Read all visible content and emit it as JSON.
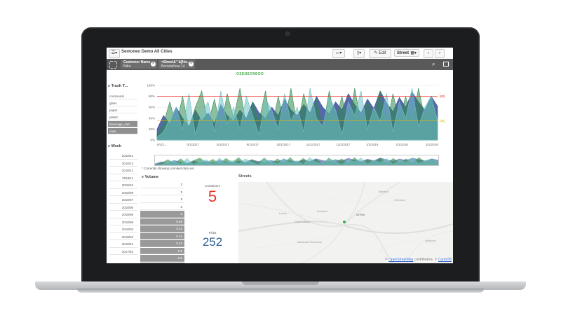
{
  "toolbar": {
    "app_title": "Semoneo Demo All Cities",
    "edit_label": "Edit",
    "sheet_name": "Street"
  },
  "selections": [
    {
      "field": "Customer Name",
      "value": "Nitra"
    },
    {
      "field": "=Street&' '&[Ho...",
      "value": "Borodačova 14"
    }
  ],
  "sheet_title": "OSENSONEOO",
  "trash_panel": {
    "title": "Trash T...",
    "items": [
      {
        "label": "communal",
        "selected": false
      },
      {
        "label": "glass",
        "selected": false
      },
      {
        "label": "paper",
        "selected": false
      },
      {
        "label": "plastic",
        "selected": false
      },
      {
        "label": "beverage_cart...",
        "selected": true
      },
      {
        "label": "cans",
        "selected": true
      }
    ]
  },
  "week_panel": {
    "title": "Week",
    "items": [
      "2018/14",
      "2018/13",
      "2018/12",
      "2018/11",
      "2018/10",
      "2018/08",
      "2018/07",
      "2018/06",
      "2018/05",
      "2018/09",
      "2018/03",
      "2018/02",
      "2018/01",
      "2017/52"
    ]
  },
  "volume_panel": {
    "title": "Volume",
    "values": [
      "3",
      "3",
      "3",
      "3",
      "0",
      "0.68",
      "0.11",
      "0.14",
      "0.24",
      "0.5",
      "0.5",
      "0.74"
    ]
  },
  "kpis": {
    "containers_label": "Containers",
    "containers_value": "5",
    "picks_label": "Picks",
    "picks_value": "252",
    "containers_color": "#e8322a",
    "picks_color": "#2b5f93"
  },
  "streets_panel": {
    "title": "Streets",
    "attribution_prefix": "© ",
    "osm_link": "OpenStreetMap",
    "attribution_mid": " contributors, © ",
    "carto_link": "CartoDB",
    "map_labels": [
      "NITRA",
      "Lehota",
      "Dolné Krškany",
      "Mlynárce",
      "Chrenová",
      "Klokočina",
      "Nitrianske Hrnčiarovce",
      "Janíkovce"
    ]
  },
  "limited_note": "* Currently showing a limited data set.",
  "chart_data": {
    "type": "area",
    "y_tick_labels": [
      "100%",
      "80%",
      "60%",
      "40%",
      "20%",
      "0%"
    ],
    "x_tick_labels": [
      "6/1/2...",
      "0/1/2017",
      "8/1/2017",
      "9/1/2017",
      "10/1/2017",
      "11/1/2017",
      "12/1/2017",
      "1/1/2018",
      "2/1/2018",
      "3/1/2018"
    ],
    "ylim": [
      0,
      100
    ],
    "reference_lines": [
      {
        "label": "[80]",
        "value": 80,
        "color": "#e8322a"
      },
      {
        "label": "[35]",
        "value": 35,
        "color": "#f4b400"
      }
    ],
    "series_colors": [
      "#3b4f9a",
      "#2f8a4f",
      "#6fc2c7",
      "#9ed3d6"
    ],
    "series": [
      {
        "values": [
          20,
          45,
          30,
          60,
          40,
          25,
          55,
          35,
          50,
          30,
          65,
          45,
          35,
          55,
          40,
          70,
          50,
          40,
          60,
          45,
          75,
          55,
          45,
          65,
          50,
          80,
          60,
          48,
          70,
          55,
          85,
          65,
          50,
          75,
          58,
          90,
          68,
          52,
          78,
          60,
          88,
          70,
          55,
          80,
          62
        ]
      },
      {
        "values": [
          10,
          30,
          70,
          25,
          80,
          20,
          60,
          90,
          30,
          75,
          20,
          85,
          40,
          95,
          25,
          70,
          35,
          90,
          20,
          80,
          30,
          95,
          25,
          85,
          40,
          75,
          20,
          90,
          35,
          80,
          25,
          95,
          30,
          70,
          45,
          90,
          25,
          85,
          35,
          80,
          30,
          95,
          40,
          75,
          30
        ]
      },
      {
        "values": [
          5,
          15,
          40,
          60,
          20,
          85,
          10,
          50,
          70,
          15,
          90,
          30,
          60,
          20,
          80,
          45,
          10,
          75,
          55,
          20,
          85,
          35,
          60,
          15,
          95,
          40,
          25,
          80,
          55,
          10,
          70,
          45,
          90,
          20,
          60,
          35,
          85,
          15,
          70,
          40,
          95,
          25,
          60,
          80,
          35
        ]
      }
    ]
  }
}
